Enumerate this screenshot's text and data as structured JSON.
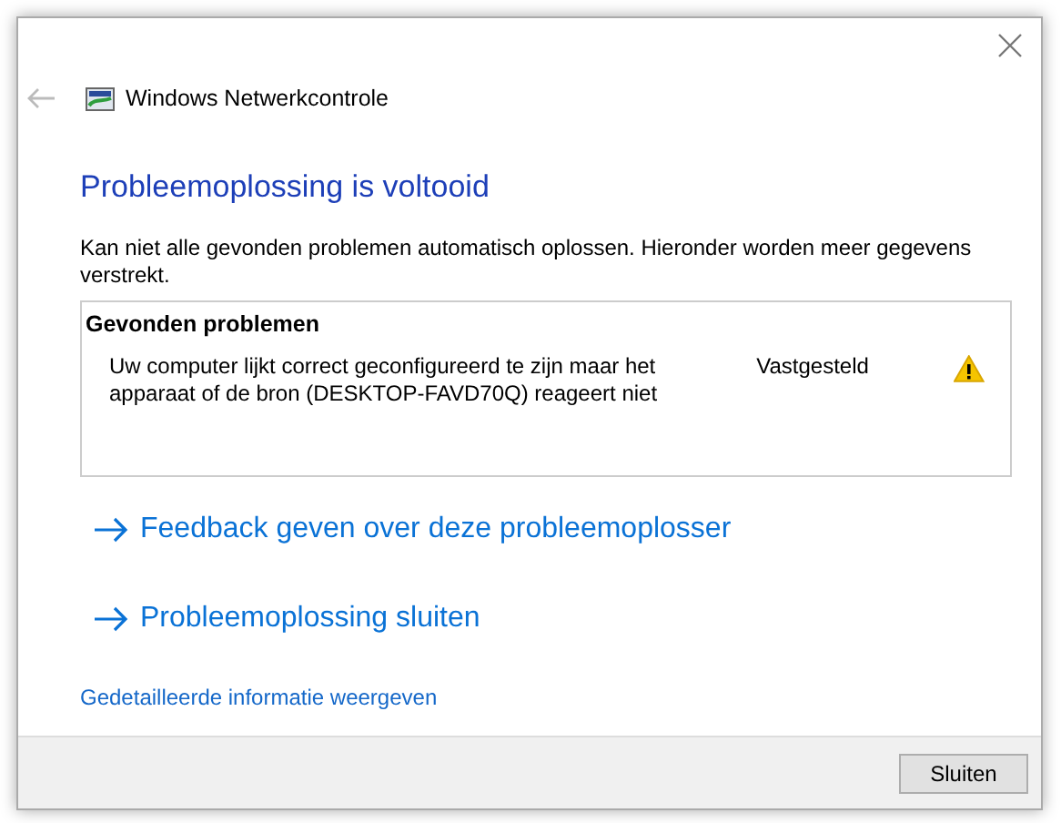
{
  "window": {
    "title": "Windows Netwerkcontrole"
  },
  "heading": "Probleemoplossing is voltooid",
  "description": "Kan niet alle gevonden problemen automatisch oplossen. Hieronder worden meer gegevens verstrekt.",
  "problems": {
    "title": "Gevonden problemen",
    "items": [
      {
        "text": "Uw computer lijkt correct geconfigureerd te zijn maar het apparaat of de bron (DESKTOP-FAVD70Q) reageert niet",
        "status": "Vastgesteld",
        "kind": "warning"
      }
    ]
  },
  "links": [
    "Feedback geven over deze probleemoplosser",
    "Probleemoplossing sluiten"
  ],
  "details_link": "Gedetailleerde informatie weergeven",
  "buttons": [
    "Sluiten"
  ]
}
